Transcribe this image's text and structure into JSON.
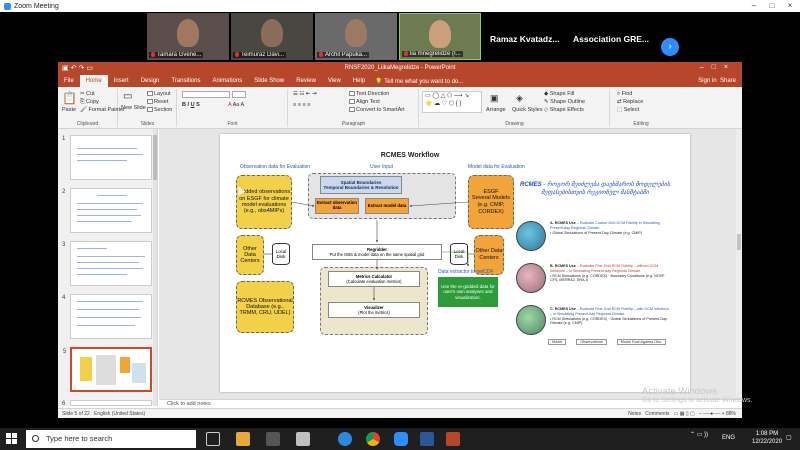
{
  "zoom": {
    "title": "Zoom Meeting",
    "participants": [
      {
        "name": "Tamara Gvene..."
      },
      {
        "name": "Teimuraz Davi..."
      },
      {
        "name": "Archil Papuka..."
      },
      {
        "name": "lia mnegrelidze (I..."
      }
    ],
    "name_tiles": [
      "Ramaz Kvatadz...",
      "Association GRE..."
    ]
  },
  "powerpoint": {
    "doc_title": "RNSF2020_LiikaMegrelidze - PowerPoint",
    "tabs": [
      "File",
      "Home",
      "Insert",
      "Design",
      "Transitions",
      "Animations",
      "Slide Show",
      "Review",
      "View",
      "Help"
    ],
    "tell_me": "Tell me what you want to do...",
    "sign_in": "Sign in",
    "share": "Share",
    "ribbon": {
      "clipboard": {
        "label": "Clipboard",
        "paste": "Paste",
        "cut": "Cut",
        "copy": "Copy",
        "format_painter": "Format Painter"
      },
      "slides": {
        "label": "Slides",
        "new_slide": "New Slide",
        "layout": "Layout",
        "reset": "Reset",
        "section": "Section"
      },
      "font": {
        "label": "Font"
      },
      "paragraph": {
        "label": "Paragraph",
        "text_direction": "Text Direction",
        "align_text": "Align Text",
        "convert_smartart": "Convert to SmartArt"
      },
      "drawing": {
        "label": "Drawing",
        "arrange": "Arrange",
        "quick_styles": "Quick Styles",
        "shape_fill": "Shape Fill",
        "shape_outline": "Shape Outline",
        "shape_effects": "Shape Effects"
      },
      "editing": {
        "label": "Editing",
        "find": "Find",
        "replace": "Replace",
        "select": "Select"
      }
    },
    "thumb_numbers": [
      "1",
      "2",
      "3",
      "4",
      "5",
      "6"
    ],
    "notes_placeholder": "Click to add notes",
    "status": {
      "slide": "Slide 5 of 22",
      "language": "English (United States)",
      "notes": "Notes",
      "comments": "Comments",
      "zoom": "88%"
    }
  },
  "slide": {
    "title": "RCMES Workflow",
    "obs_header": "Observation data for Evaluation",
    "user_input_header": "User Input",
    "model_header": "Model data for Evaluation",
    "gridded": "Gridded observations on ESGF for climate model evaluations (e.g., obs4MIPs)",
    "other_data_left": "Other Data Centers",
    "local_disk": "Local Disk",
    "rcmes_db": "RCMES Observational Database (e.g., TRMM, CRU, UDEL)",
    "spatial": "Spatial Boundaries",
    "temporal": "Temporal Boundaries & Resolution",
    "extract_obs": "Extract observation data",
    "extract_model": "Extract model data",
    "esgf": "ESGF",
    "several_models": "Several Models",
    "esgf_eg": "(e.g. CMIP, CORDEX)",
    "other_data_right": "Other Data Centers",
    "regridder": "Regridder",
    "regridder_sub": "Put the OBS & model data on the same spatial grid",
    "metrics": "Metrics Calculator",
    "metrics_sub": "(Calculate evaluation metrics)",
    "visualizer": "Visualizer",
    "visualizer_sub": "(Plot the metrics)",
    "data_extractor": "Data extractor to netCDF",
    "green_text": "Use the re-gridded data for user's own analyses and visualization.",
    "geo_prefix": "RCMES",
    "geo_title": "- როგორ შეიძლება დაეხმაროს მოდელების შეფასებისთვის რეგიონულ მასშტაბში",
    "globes": [
      {
        "heading": "A. RCMES Use",
        "rest": "– Evaluate Coarse-Grid GCM Fidelity in Simulating Present-day Regional Climate.",
        "bullet": "Global Simulations of Present-Day Climate (e.g. CMIP)"
      },
      {
        "heading": "B. RCMES Use",
        "rest": "– Evaluate Fine-Grid RCM Fidelity – without GCM Influence – in Simulating Present-day Regional Climate.",
        "bullet": "RCM Simulations (e.g. CORDEX) · Boundary Conditions (e.g. NCEP CFS, MERRA2, ERA-I)"
      },
      {
        "heading": "C. RCMES Use",
        "rest": "– Evaluate Fine-Grid RCM Fidelity – with GCM Influence – in Simulating Present-day Regional Climate.",
        "bullet": "RCM Simulations (e.g. CORDEX) · Global Simulations of Present-Day Climate (e.g. CMIP)"
      }
    ],
    "legend": [
      "Model",
      "Observations",
      "Model Eval Against Obs."
    ]
  },
  "watermark": {
    "line1": "Activate Windows",
    "line2": "Go to Settings to activate Windows."
  },
  "taskbar": {
    "search_placeholder": "Type here to search",
    "language": "ENG",
    "time": "1:08 PM",
    "date": "12/22/2020"
  },
  "colors": {
    "ppt_accent": "#B7472A",
    "zoom_blue": "#2D8CFF"
  }
}
